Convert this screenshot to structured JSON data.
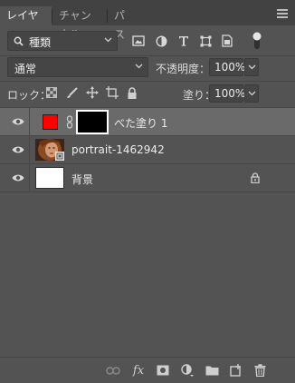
{
  "tabs": [
    {
      "label": "レイヤー",
      "active": true
    },
    {
      "label": "チャンネル",
      "active": false
    },
    {
      "label": "パス",
      "active": false
    }
  ],
  "filter": {
    "label": "種類"
  },
  "blend_mode": {
    "value": "通常"
  },
  "opacity": {
    "label": "不透明度：",
    "value": "100%"
  },
  "lock": {
    "label": "ロック："
  },
  "fill": {
    "label": "塗り：",
    "value": "100%"
  },
  "layers": [
    {
      "name": "べた塗り 1",
      "selected": true,
      "fill_color": "#ff0000",
      "mask_color": "#000000"
    },
    {
      "name": "portrait-1462942",
      "selected": false
    },
    {
      "name": "背景",
      "selected": false,
      "locked": true
    }
  ],
  "bottom_icons": [
    "link-icon",
    "fx-icon",
    "mask-icon",
    "adjustment-icon",
    "folder-icon",
    "new-layer-icon",
    "trash-icon"
  ],
  "fx_text": "fx",
  "colors": {
    "panel": "#535353",
    "tabbar": "#424242",
    "selected_row": "#6a6a6a",
    "text": "#ececec"
  }
}
